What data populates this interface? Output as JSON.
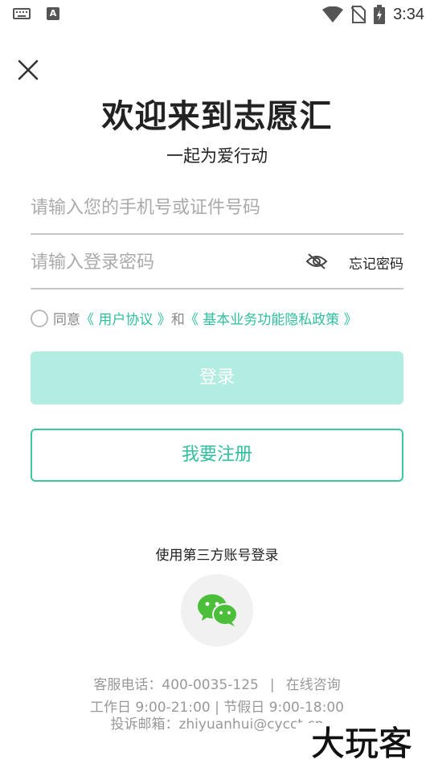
{
  "status_bar": {
    "time": "3:34",
    "icons": [
      "keyboard-icon",
      "a-icon",
      "wifi-icon",
      "no-sim-icon",
      "battery-charging-icon"
    ],
    "a_icon_label": "A"
  },
  "header": {
    "title": "欢迎来到志愿汇",
    "subtitle": "一起为爱行动"
  },
  "form": {
    "phone_placeholder": "请输入您的手机号或证件号码",
    "password_placeholder": "请输入登录密码",
    "forgot_label": "忘记密码"
  },
  "agreement": {
    "prefix": "同意",
    "user_agreement": "《 用户协议 》",
    "and": "和",
    "privacy_policy": "《 基本业务功能隐私政策 》"
  },
  "buttons": {
    "login": "登录",
    "register": "我要注册"
  },
  "third_party": {
    "label": "使用第三方账号登录",
    "icon": "wechat-icon"
  },
  "footer": {
    "hotline": "客服电话：400-0035-125",
    "separator": "|",
    "online_consult": "在线咨询",
    "hours": "工作日 9:00-21:00 | 节假日 9:00-18:00",
    "email": "投诉邮箱：zhiyuanhui@cycct.cn"
  },
  "watermark": {
    "text": "大玩客"
  },
  "colors": {
    "accent": "#2fbf9f",
    "login_disabled": "#b3ede1",
    "wechat_green": "#4cbf3a"
  }
}
